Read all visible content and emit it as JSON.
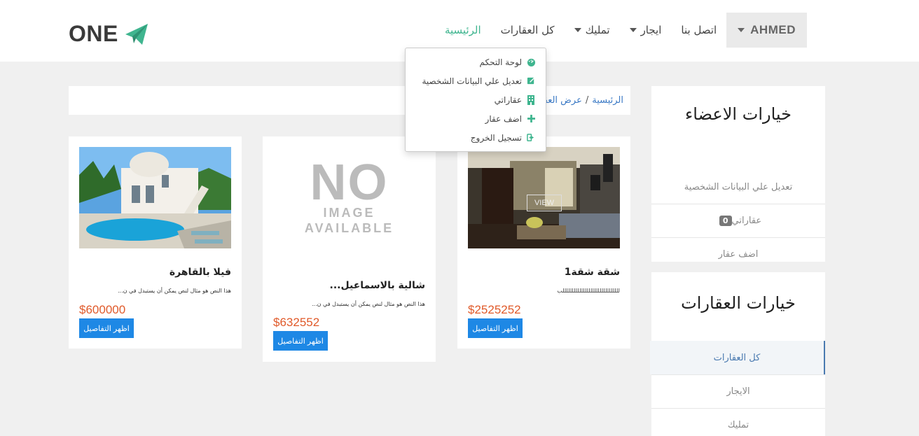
{
  "header": {
    "logo_text": "ONE",
    "nav": [
      {
        "label": "الرئيسية",
        "active": true,
        "caret": false
      },
      {
        "label": "كل العقارات",
        "active": false,
        "caret": false
      },
      {
        "label": "تمليك",
        "active": false,
        "caret": true
      },
      {
        "label": "ايجار",
        "active": false,
        "caret": true
      },
      {
        "label": "اتصل بنا",
        "active": false,
        "caret": false
      }
    ],
    "user_label": "AHMED"
  },
  "user_menu": {
    "items": [
      {
        "label": "لوحة التحكم",
        "icon": "dashboard-icon"
      },
      {
        "label": "تعديل علي البيانات الشخصية",
        "icon": "edit-icon"
      },
      {
        "label": "عقاراتي",
        "icon": "building-icon"
      },
      {
        "label": "اضف عقار",
        "icon": "plus-icon"
      },
      {
        "label": "تسجيل الخروج",
        "icon": "logout-icon"
      }
    ]
  },
  "breadcrumb": {
    "home": "الرئيسية",
    "separator": "/",
    "current": "عرض العقارات"
  },
  "cards": [
    {
      "title": "شقة شقة1",
      "desc": "لللللللللللللللللللللللللللللللب",
      "price": "$2525252",
      "button": "اظهر التفاصيل",
      "overlay": "VIEW"
    },
    {
      "title": "شالية بالاسماعيل...",
      "desc": "هذا النص هو مثال لنص يمكن أن يستبدل في ن...",
      "price": "$632552",
      "button": "اظهر التفاصيل",
      "noimg_big": "NO",
      "noimg_line1": "IMAGE",
      "noimg_line2": "AVAILABLE"
    },
    {
      "title": "فيلا بالقاهرة",
      "desc": "هذا النص هو مثال لنص يمكن أن يستبدل في ن...",
      "price": "$600000",
      "button": "اظهر التفاصيل"
    }
  ],
  "sidebar_members": {
    "title": "خيارات الاعضاء",
    "items": [
      {
        "label": "تعديل علي البيانات الشخصية"
      },
      {
        "label": "عقاراتي",
        "badge": "0"
      },
      {
        "label": "اضف عقار"
      }
    ]
  },
  "sidebar_properties": {
    "title": "خيارات العقارات",
    "items": [
      {
        "label": "كل العقارات",
        "active": true
      },
      {
        "label": "الايجار"
      },
      {
        "label": "تمليك"
      }
    ]
  },
  "colors": {
    "accent": "#3fb58f",
    "price": "#e05a2a",
    "button": "#1e88e5",
    "link": "#3a79c5"
  }
}
